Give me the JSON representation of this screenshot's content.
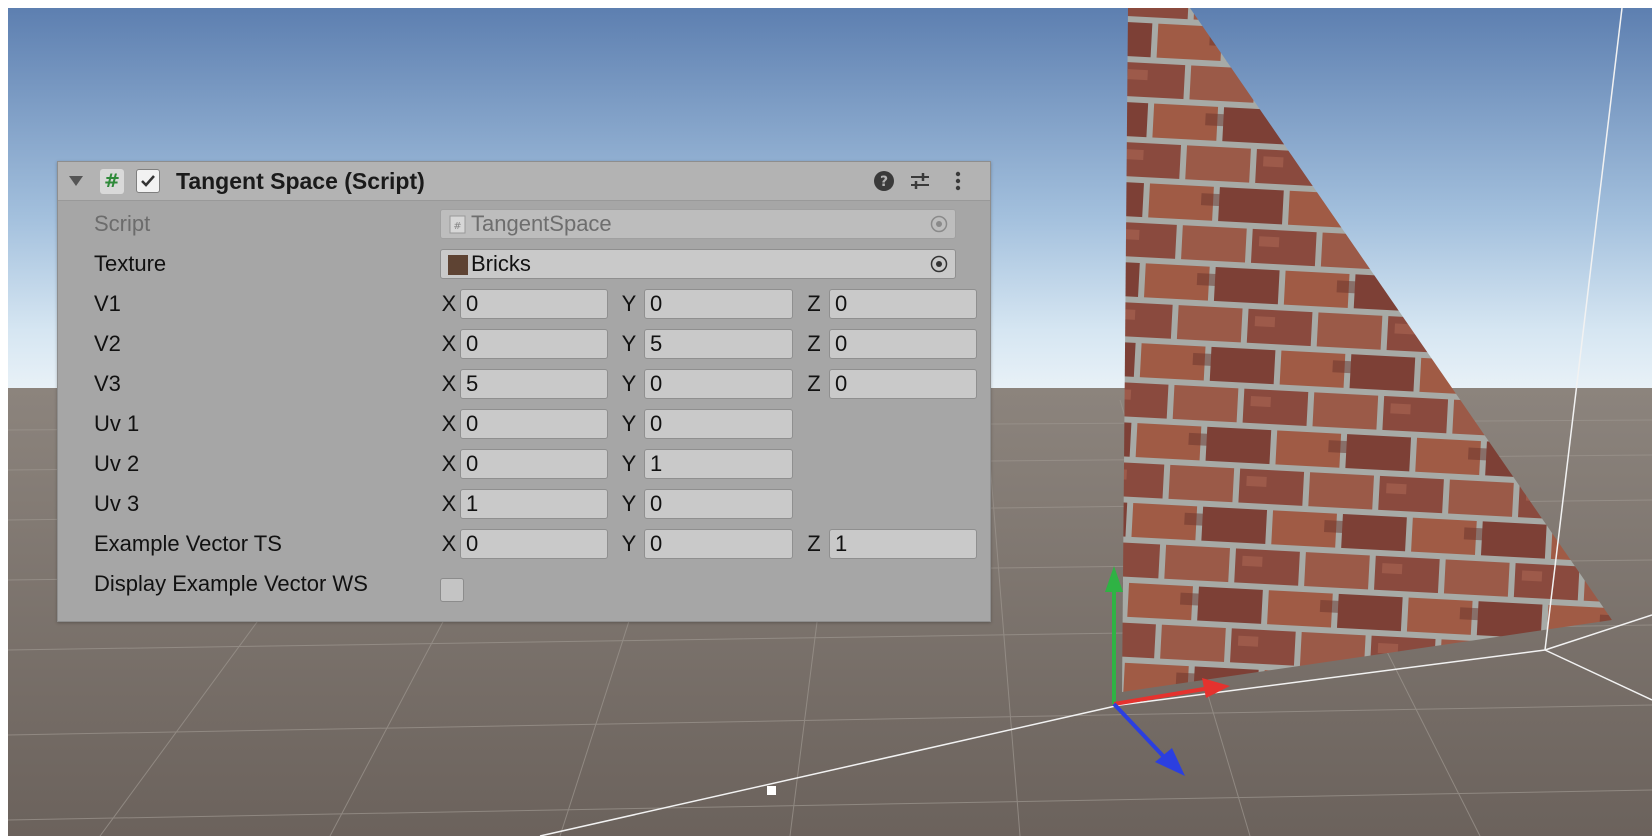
{
  "component": {
    "title": "Tangent Space (Script)",
    "enabled": true,
    "icons": [
      "foldout-arrow-icon",
      "script-icon",
      "help-icon",
      "presets-icon",
      "more-options-icon"
    ]
  },
  "fields": {
    "script": {
      "label": "Script",
      "value": "TangentSpace"
    },
    "texture": {
      "label": "Texture",
      "value": "Bricks"
    },
    "v1": {
      "label": "V1",
      "x": "0",
      "y": "0",
      "z": "0"
    },
    "v2": {
      "label": "V2",
      "x": "0",
      "y": "5",
      "z": "0"
    },
    "v3": {
      "label": "V3",
      "x": "5",
      "y": "0",
      "z": "0"
    },
    "uv1": {
      "label": "Uv 1",
      "x": "0",
      "y": "0"
    },
    "uv2": {
      "label": "Uv 2",
      "x": "0",
      "y": "1"
    },
    "uv3": {
      "label": "Uv 3",
      "x": "1",
      "y": "0"
    },
    "example_ts": {
      "label": "Example Vector TS",
      "x": "0",
      "y": "0",
      "z": "1"
    },
    "display_ws": {
      "label": "Display Example Vector WS",
      "checked": false
    }
  },
  "axis_labels": {
    "x": "X",
    "y": "Y",
    "z": "Z"
  },
  "colors": {
    "panel": "#a6a6a6",
    "gizmo_x": "#e5322e",
    "gizmo_y": "#2fb344",
    "gizmo_z": "#2b3fe0"
  }
}
